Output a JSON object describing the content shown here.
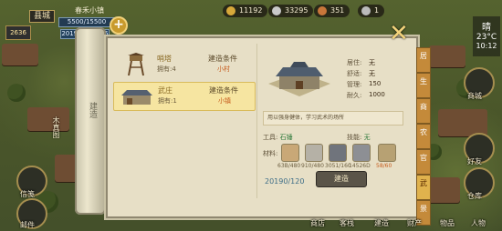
{
  "player": {
    "city_tag": "县城",
    "name": "春禾小镇",
    "population": "5500/15500",
    "level": "2636",
    "money": "2019060/6635"
  },
  "resources": [
    {
      "icon": "coin-icon",
      "value": "11192",
      "color": "#d7a83a"
    },
    {
      "icon": "ingot-icon",
      "value": "33295",
      "color": "#c9c9c9"
    },
    {
      "icon": "copper-icon",
      "value": "351",
      "color": "#c8763a"
    },
    {
      "icon": "stone-icon",
      "value": "1",
      "color": "#bbbbbb"
    }
  ],
  "clock": {
    "weather": "晴",
    "temp": "23°C",
    "time": "10:12"
  },
  "scroll": {
    "label": "建造"
  },
  "build_list": [
    {
      "name": "哨塔",
      "owned": "拥有:4",
      "cond_label": "建造条件",
      "cond_value": "小村"
    },
    {
      "name": "武庄",
      "owned": "拥有:1",
      "cond_label": "建造条件",
      "cond_value": "小镇"
    }
  ],
  "detail": {
    "stats": [
      {
        "label": "居住:",
        "value": "无"
      },
      {
        "label": "舒适:",
        "value": "无"
      },
      {
        "label": "管理:",
        "value": "150"
      },
      {
        "label": "耐久:",
        "value": "1000"
      }
    ],
    "description": "用以强身健体，学习武术的场所",
    "tool_label": "工具:",
    "tool_value": "石锤",
    "tech_label": "技能:",
    "tech_value": "无",
    "materials_label": "材料:",
    "materials": [
      {
        "name": "wood-material-icon",
        "amount": "63B/480"
      },
      {
        "name": "stone-material-icon",
        "amount": "910/480"
      },
      {
        "name": "tile-material-icon",
        "amount": "3051/160"
      },
      {
        "name": "iron-material-icon",
        "amount": "14526D"
      },
      {
        "name": "rope-material-icon",
        "amount": "58/60"
      }
    ],
    "cost": "20190/120",
    "build_button": "建造"
  },
  "side_tabs": [
    "居",
    "生",
    "商",
    "农",
    "官",
    "武",
    "景"
  ],
  "left_menu": [
    {
      "icon": "ranking-icon",
      "label": "木真图"
    },
    {
      "icon": "scroll-map-icon",
      "label": "信笺"
    },
    {
      "icon": "mail-icon",
      "label": "邮件"
    }
  ],
  "right_menu": [
    {
      "icon": "shop-icon",
      "label": "商城"
    },
    {
      "icon": "friends-icon",
      "label": "好友"
    },
    {
      "icon": "warehouse-icon",
      "label": "仓库"
    }
  ],
  "bottom_menu": [
    "商店",
    "客栈",
    "建造",
    "财产",
    "物品",
    "人物"
  ]
}
